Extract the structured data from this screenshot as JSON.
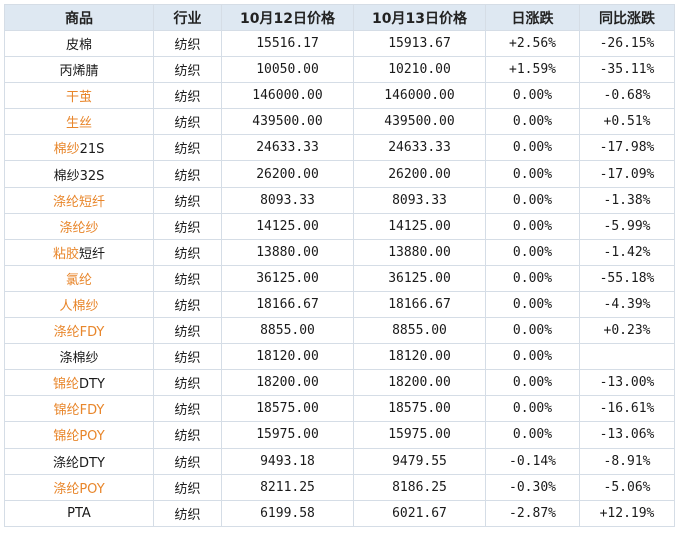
{
  "header": {
    "name": "商品",
    "industry": "行业",
    "price1": "10月12日价格",
    "price2": "10月13日价格",
    "daily": "日涨跌",
    "yoy": "同比涨跌"
  },
  "colors": {
    "highlight": "#e8862b",
    "up": "#e0161d",
    "down": "#1d8a1d",
    "header_bg": "#dee8f2",
    "border": "#d5dde6"
  },
  "rows": [
    {
      "name": [
        {
          "t": "皮棉",
          "c": "n"
        }
      ],
      "industry": "纺织",
      "p1": "15516.17",
      "p2": "15913.67",
      "daily": "+2.56%",
      "daily_dir": "up",
      "yoy": "-26.15%",
      "yoy_dir": "down"
    },
    {
      "name": [
        {
          "t": "丙烯腈",
          "c": "n"
        }
      ],
      "industry": "纺织",
      "p1": "10050.00",
      "p2": "10210.00",
      "daily": "+1.59%",
      "daily_dir": "up",
      "yoy": "-35.11%",
      "yoy_dir": "down"
    },
    {
      "name": [
        {
          "t": "干茧",
          "c": "h"
        }
      ],
      "industry": "纺织",
      "p1": "146000.00",
      "p2": "146000.00",
      "daily": "0.00%",
      "daily_dir": "flat",
      "yoy": "-0.68%",
      "yoy_dir": "down"
    },
    {
      "name": [
        {
          "t": "生丝",
          "c": "h"
        }
      ],
      "industry": "纺织",
      "p1": "439500.00",
      "p2": "439500.00",
      "daily": "0.00%",
      "daily_dir": "flat",
      "yoy": "+0.51%",
      "yoy_dir": "up"
    },
    {
      "name": [
        {
          "t": "棉纱",
          "c": "h"
        },
        {
          "t": "21S",
          "c": "n"
        }
      ],
      "industry": "纺织",
      "p1": "24633.33",
      "p2": "24633.33",
      "daily": "0.00%",
      "daily_dir": "flat",
      "yoy": "-17.98%",
      "yoy_dir": "down"
    },
    {
      "name": [
        {
          "t": "棉纱32S",
          "c": "n"
        }
      ],
      "industry": "纺织",
      "p1": "26200.00",
      "p2": "26200.00",
      "daily": "0.00%",
      "daily_dir": "flat",
      "yoy": "-17.09%",
      "yoy_dir": "down"
    },
    {
      "name": [
        {
          "t": "涤纶短纤",
          "c": "h"
        }
      ],
      "industry": "纺织",
      "p1": "8093.33",
      "p2": "8093.33",
      "daily": "0.00%",
      "daily_dir": "flat",
      "yoy": "-1.38%",
      "yoy_dir": "down"
    },
    {
      "name": [
        {
          "t": "涤纶纱",
          "c": "h"
        }
      ],
      "industry": "纺织",
      "p1": "14125.00",
      "p2": "14125.00",
      "daily": "0.00%",
      "daily_dir": "flat",
      "yoy": "-5.99%",
      "yoy_dir": "down"
    },
    {
      "name": [
        {
          "t": "粘胶",
          "c": "h"
        },
        {
          "t": "短纤",
          "c": "n"
        }
      ],
      "industry": "纺织",
      "p1": "13880.00",
      "p2": "13880.00",
      "daily": "0.00%",
      "daily_dir": "flat",
      "yoy": "-1.42%",
      "yoy_dir": "down"
    },
    {
      "name": [
        {
          "t": "氯纶",
          "c": "h"
        }
      ],
      "industry": "纺织",
      "p1": "36125.00",
      "p2": "36125.00",
      "daily": "0.00%",
      "daily_dir": "flat",
      "yoy": "-55.18%",
      "yoy_dir": "down"
    },
    {
      "name": [
        {
          "t": "人棉纱",
          "c": "h"
        }
      ],
      "industry": "纺织",
      "p1": "18166.67",
      "p2": "18166.67",
      "daily": "0.00%",
      "daily_dir": "flat",
      "yoy": "-4.39%",
      "yoy_dir": "down"
    },
    {
      "name": [
        {
          "t": "涤纶FDY",
          "c": "h"
        }
      ],
      "industry": "纺织",
      "p1": "8855.00",
      "p2": "8855.00",
      "daily": "0.00%",
      "daily_dir": "flat",
      "yoy": "+0.23%",
      "yoy_dir": "up"
    },
    {
      "name": [
        {
          "t": "涤棉纱",
          "c": "n"
        }
      ],
      "industry": "纺织",
      "p1": "18120.00",
      "p2": "18120.00",
      "daily": "0.00%",
      "daily_dir": "flat",
      "yoy": "",
      "yoy_dir": "flat"
    },
    {
      "name": [
        {
          "t": "锦纶",
          "c": "h"
        },
        {
          "t": "DTY",
          "c": "n"
        }
      ],
      "industry": "纺织",
      "p1": "18200.00",
      "p2": "18200.00",
      "daily": "0.00%",
      "daily_dir": "flat",
      "yoy": "-13.00%",
      "yoy_dir": "down"
    },
    {
      "name": [
        {
          "t": "锦纶FDY",
          "c": "h"
        }
      ],
      "industry": "纺织",
      "p1": "18575.00",
      "p2": "18575.00",
      "daily": "0.00%",
      "daily_dir": "flat",
      "yoy": "-16.61%",
      "yoy_dir": "down"
    },
    {
      "name": [
        {
          "t": "锦纶",
          "c": "h"
        },
        {
          "t": "POY",
          "c": "h"
        }
      ],
      "industry": "纺织",
      "p1": "15975.00",
      "p2": "15975.00",
      "daily": "0.00%",
      "daily_dir": "flat",
      "yoy": "-13.06%",
      "yoy_dir": "down"
    },
    {
      "name": [
        {
          "t": "涤纶DTY",
          "c": "n"
        }
      ],
      "industry": "纺织",
      "p1": "9493.18",
      "p2": "9479.55",
      "daily": "-0.14%",
      "daily_dir": "down",
      "yoy": "-8.91%",
      "yoy_dir": "down"
    },
    {
      "name": [
        {
          "t": "涤纶POY",
          "c": "h"
        }
      ],
      "industry": "纺织",
      "p1": "8211.25",
      "p2": "8186.25",
      "daily": "-0.30%",
      "daily_dir": "down",
      "yoy": "-5.06%",
      "yoy_dir": "down"
    },
    {
      "name": [
        {
          "t": "PTA",
          "c": "n"
        }
      ],
      "industry": "纺织",
      "p1": "6199.58",
      "p2": "6021.67",
      "daily": "-2.87%",
      "daily_dir": "down",
      "yoy": "+12.19%",
      "yoy_dir": "up"
    }
  ]
}
